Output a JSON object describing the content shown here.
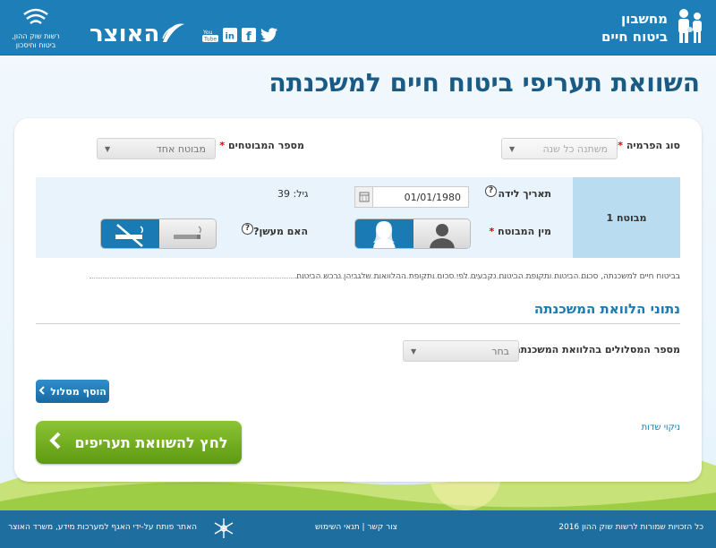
{
  "header": {
    "calc_title_line1": "מחשבון",
    "calc_title_line2": "ביטוח חיים",
    "site_logo": "האוצר",
    "authority_logo": "רשות שוק ההון, ביטוח וחיסכון",
    "social": [
      "twitter-icon",
      "facebook-icon",
      "linkedin-icon",
      "youtube-icon"
    ]
  },
  "page_title": "השוואת תעריפי ביטוח חיים למשכנתה",
  "form": {
    "premium_type_label": "סוג הפרמיה",
    "premium_type_value": "משתנה כל שנה",
    "insured_count_label": "מספר המבוטחים",
    "insured_count_value": "מבוטח אחד",
    "insured_tab": "מבוטח 1",
    "birth_date_label": "תאריך לידה",
    "birth_date_value": "01/01/1980",
    "age_label": "גיל:",
    "age_value": "39",
    "gender_label": "מין המבוטח",
    "smoker_label": "האם מעשן?",
    "help_symbol": "?",
    "required_mark": "*",
    "note": "בביטוח חיים למשכנתה, סכום הביטוח ותקופת הביטוח נקבעים לפי סכום ותקופת ההלוואות שלגביהן נרכש הביטוח."
  },
  "loan_section": {
    "title": "נתוני הלוואת המשכנתה",
    "tracks_label": "מספר המסלולים בהלוואת המשכנתה",
    "tracks_value": "בחר",
    "add_track_button": "הוסף מסלול",
    "compare_button": "לחץ להשוואת תעריפים",
    "clear_fields": "ניקוי שדות"
  },
  "footer": {
    "copyright": "כל הזכויות שמורות לרשות שוק ההון 2016",
    "links": "צור קשר | תנאי השימוש",
    "credit": "האתר פותח על-ידי האגף למערכות מידע, משרד האוצר"
  },
  "colors": {
    "header": "#1e7fb8",
    "title": "#1a5b86",
    "accent": "#1a7ab3",
    "cta": "#76b02a",
    "footer": "#1e6e9f"
  }
}
